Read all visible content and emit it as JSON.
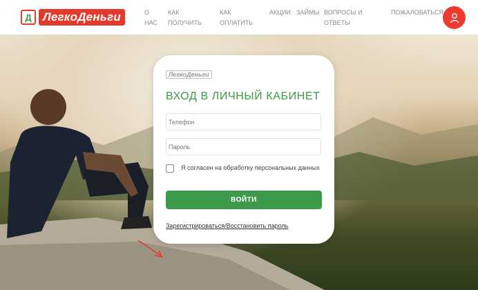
{
  "header": {
    "logo_text": "ЛегкоДеньги",
    "logo_mark": "Д",
    "nav": [
      {
        "label": "О НАС"
      },
      {
        "label": "КАК ПОЛУЧИТЬ"
      },
      {
        "label": "КАК ОПЛАТИТЬ"
      },
      {
        "label": "АКЦИИ"
      },
      {
        "label": "ЗАЙМЫ"
      },
      {
        "label": "ВОПРОСЫ И ОТВЕТЫ"
      },
      {
        "label": "ПОЖАЛОВАТЬСЯ"
      }
    ],
    "user_icon": "user-icon"
  },
  "login": {
    "logo_text": "ЛегкоДеньги",
    "title": "ВХОД В ЛИЧНЫЙ КАБИНЕТ",
    "phone_placeholder": "Телефон",
    "password_placeholder": "Пароль",
    "consent_text": "Я согласен на обработку персональных данных",
    "submit_label": "ВОЙТИ",
    "register_link": "Зарегистрироваться/Восстановить пароль"
  },
  "colors": {
    "brand_red": "#e23b2e",
    "brand_green": "#3d9a4a"
  }
}
